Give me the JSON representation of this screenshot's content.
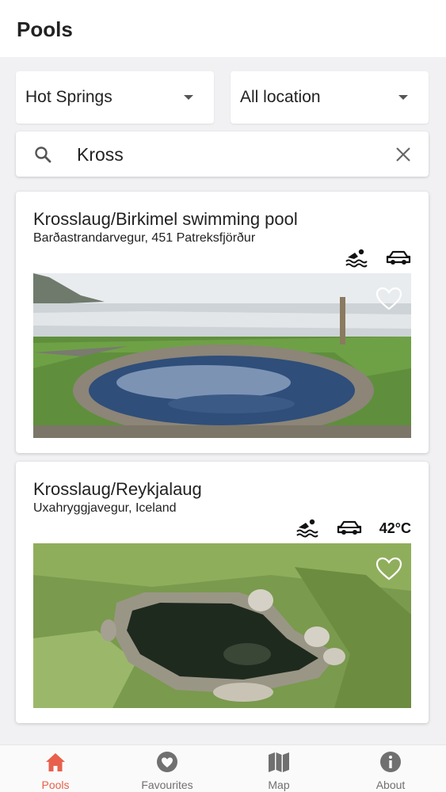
{
  "header": {
    "title": "Pools"
  },
  "filters": {
    "type_selected": "Hot Springs",
    "location_selected": "All location"
  },
  "search": {
    "value": "Kross",
    "search_icon": "search-icon",
    "clear_icon": "close-icon"
  },
  "pools": [
    {
      "name": "Krosslaug/Birkimel swimming pool",
      "address": "Barðastrandarvegur, 451 Patreksfjörður",
      "icons": [
        "swimming-icon",
        "car-icon"
      ],
      "temperature": "",
      "image": "coastal-pool-photo",
      "favourite_icon": "heart-outline-icon"
    },
    {
      "name": "Krosslaug/Reykjalaug",
      "address": "Uxahryggjavegur, Iceland",
      "icons": [
        "swimming-icon",
        "car-icon"
      ],
      "temperature": "42°C",
      "image": "grassy-spring-photo",
      "favourite_icon": "heart-outline-icon"
    }
  ],
  "bottom_nav": [
    {
      "label": "Pools",
      "icon": "home-icon",
      "active": true
    },
    {
      "label": "Favourites",
      "icon": "heart-circle-icon",
      "active": false
    },
    {
      "label": "Map",
      "icon": "map-icon",
      "active": false
    },
    {
      "label": "About",
      "icon": "info-icon",
      "active": false
    }
  ],
  "colors": {
    "accent": "#e8604c",
    "inactive": "#707070",
    "background": "#f1f1f3"
  }
}
